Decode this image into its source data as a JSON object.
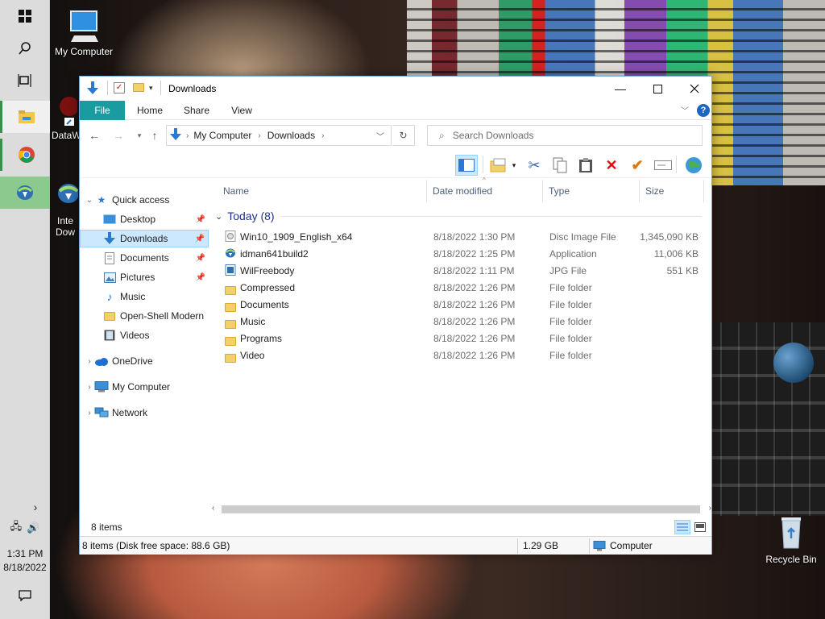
{
  "desktop": {
    "icons": {
      "my_computer": "My Computer",
      "datawiz": "DataW",
      "internet_download_top": "Inte",
      "internet_download_bottom": "Dow",
      "recycle_bin": "Recycle Bin"
    }
  },
  "taskbar": {
    "time": "1:31 PM",
    "date": "8/18/2022"
  },
  "window": {
    "title": "Downloads",
    "ribbon_tabs": [
      "File",
      "Home",
      "Share",
      "View"
    ],
    "address": {
      "crumbs": [
        "My Computer",
        "Downloads"
      ]
    },
    "search": {
      "placeholder": "Search Downloads"
    },
    "nav": {
      "quick_access": "Quick access",
      "desktop": "Desktop",
      "downloads": "Downloads",
      "documents": "Documents",
      "pictures": "Pictures",
      "music": "Music",
      "open_shell": "Open-Shell Modern",
      "videos": "Videos",
      "onedrive": "OneDrive",
      "my_computer": "My Computer",
      "network": "Network"
    },
    "columns": {
      "name": "Name",
      "date": "Date modified",
      "type": "Type",
      "size": "Size"
    },
    "group": {
      "label": "Today (8)"
    },
    "files": [
      {
        "name": "Win10_1909_English_x64",
        "date": "8/18/2022 1:30 PM",
        "type": "Disc Image File",
        "size": "1,345,090 KB",
        "icon": "disc-image-icon"
      },
      {
        "name": "idman641build2",
        "date": "8/18/2022 1:25 PM",
        "type": "Application",
        "size": "11,006 KB",
        "icon": "application-icon"
      },
      {
        "name": "WilFreebody",
        "date": "8/18/2022 1:11 PM",
        "type": "JPG File",
        "size": "551 KB",
        "icon": "image-file-icon"
      },
      {
        "name": "Compressed",
        "date": "8/18/2022 1:26 PM",
        "type": "File folder",
        "size": "",
        "icon": "folder-icon"
      },
      {
        "name": "Documents",
        "date": "8/18/2022 1:26 PM",
        "type": "File folder",
        "size": "",
        "icon": "folder-icon"
      },
      {
        "name": "Music",
        "date": "8/18/2022 1:26 PM",
        "type": "File folder",
        "size": "",
        "icon": "folder-icon"
      },
      {
        "name": "Programs",
        "date": "8/18/2022 1:26 PM",
        "type": "File folder",
        "size": "",
        "icon": "folder-icon"
      },
      {
        "name": "Video",
        "date": "8/18/2022 1:26 PM",
        "type": "File folder",
        "size": "",
        "icon": "folder-icon"
      }
    ],
    "status": {
      "item_count": "8 items",
      "bottom_info": "8 items (Disk free space: 88.6 GB)",
      "bottom_size": "1.29 GB",
      "bottom_location": "Computer"
    }
  },
  "colors": {
    "accent_file_tab": "#1a9ba0",
    "selection": "#cce8ff",
    "group_header": "#1e3287"
  }
}
